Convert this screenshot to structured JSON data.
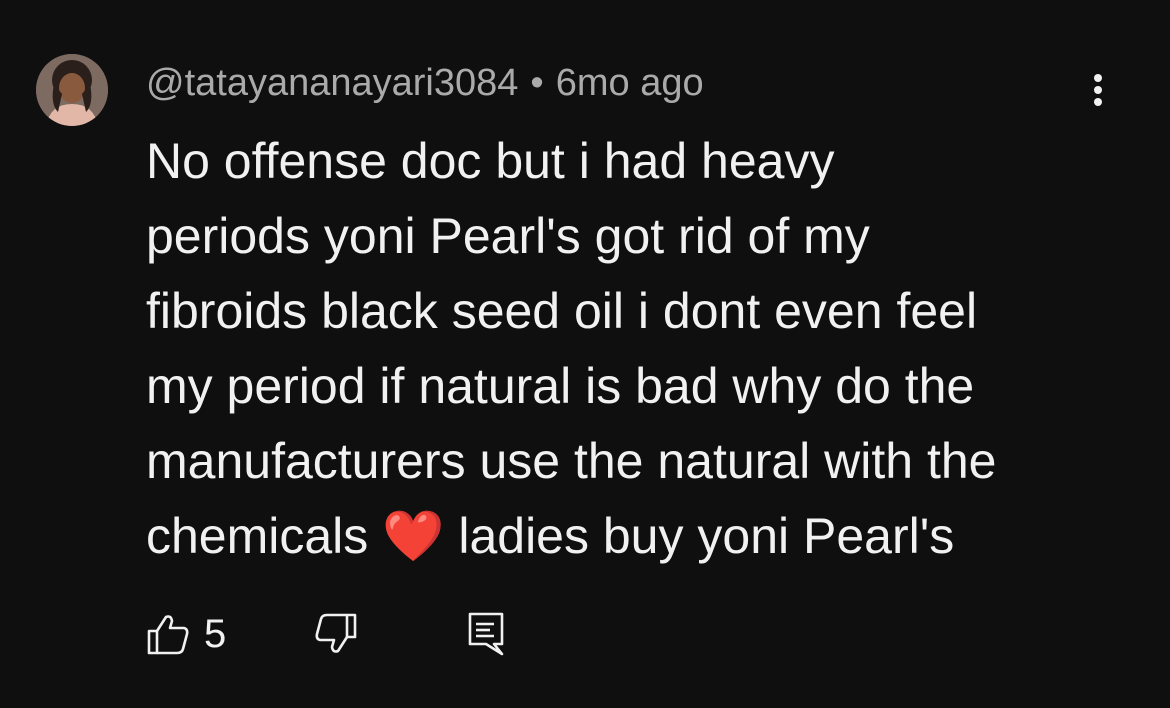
{
  "comment": {
    "author": "@tatayananayari3084",
    "separator": "•",
    "timestamp": "6mo ago",
    "text_before_emoji": "No offense doc but i had heavy\nperiods yoni Pearl's got rid of my\nfibroids black seed oil i dont even feel\nmy period if natural is bad why do the\nmanufacturers use the natural with the\nchemicals ",
    "emoji": "❤️",
    "text_after_emoji": "  ladies buy yoni Pearl's",
    "like_count": "5"
  },
  "icons": {
    "avatar": "user-avatar-photo",
    "menu": "more-vertical-icon",
    "like": "thumbs-up-icon",
    "dislike": "thumbs-down-icon",
    "reply": "reply-comment-icon"
  },
  "colors": {
    "background": "#0f0f0f",
    "primary_text": "#f1f1f1",
    "secondary_text": "#aaaaaa",
    "heart": "#e8262c"
  }
}
